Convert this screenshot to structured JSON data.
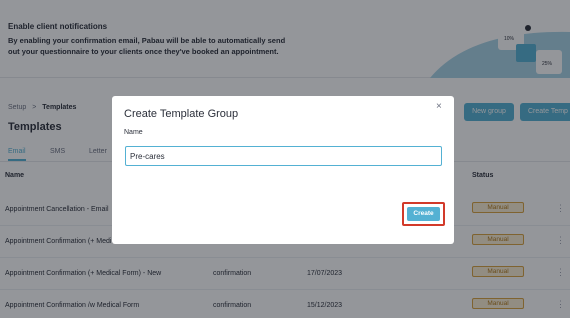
{
  "banner": {
    "title": "Enable client notifications",
    "body": "By enabling your confirmation email, Pabau will be able to automatically send out your questionnaire to your clients once they've booked an appointment.",
    "stat_a": "10%",
    "stat_b": "25%"
  },
  "breadcrumb": {
    "root": "Setup",
    "separator": ">",
    "current": "Templates"
  },
  "page_title": "Templates",
  "actions": {
    "new_group": "New group",
    "create_template": "Create Temp"
  },
  "tabs": [
    "Email",
    "SMS",
    "Letter"
  ],
  "active_tab": "Email",
  "table": {
    "headers": {
      "name": "Name",
      "status": "Status"
    },
    "rows": [
      {
        "name": "Appointment Cancellation - Email",
        "type": "",
        "date": "",
        "status": "Manual"
      },
      {
        "name": "Appointment Confirmation (+ Medi",
        "type": "",
        "date": "",
        "status": "Manual"
      },
      {
        "name": "Appointment Confirmation (+ Medical Form) - New",
        "type": "confirmation",
        "date": "17/07/2023",
        "status": "Manual"
      },
      {
        "name": "Appointment Confirmation /w Medical Form",
        "type": "confirmation",
        "date": "15/12/2023",
        "status": "Manual"
      }
    ]
  },
  "modal": {
    "title": "Create Template Group",
    "close_icon": "×",
    "name_label": "Name",
    "name_value": "Pre-cares",
    "create_label": "Create"
  },
  "colors": {
    "accent": "#54b1d3",
    "highlight": "#d23a2a",
    "badge": "#d9a23f"
  }
}
